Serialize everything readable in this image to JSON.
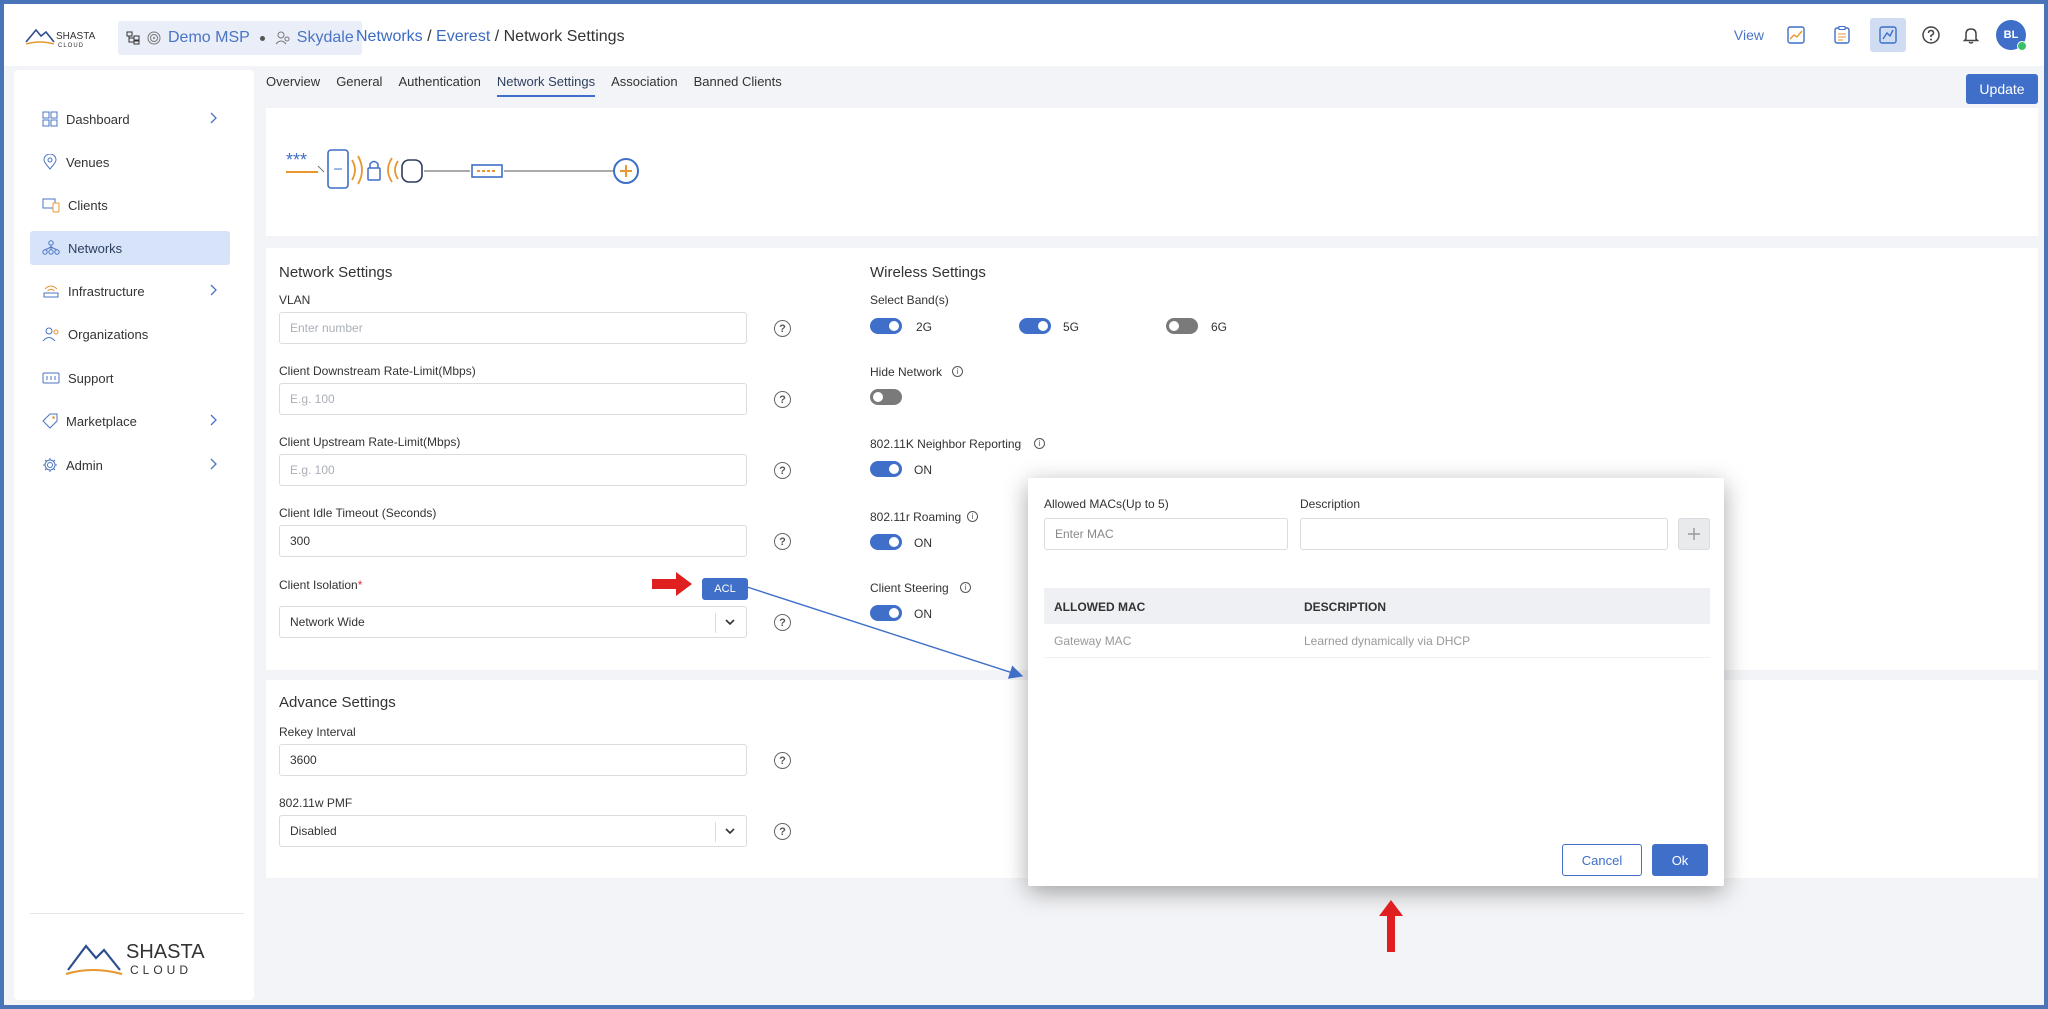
{
  "header": {
    "context": {
      "msp": "Demo MSP",
      "org": "Skydale"
    },
    "breadcrumb": [
      {
        "label": "Networks",
        "link": true
      },
      {
        "label": "Everest",
        "link": true
      },
      {
        "label": "Network Settings",
        "link": false
      }
    ],
    "view_label": "View",
    "avatar_initials": "BL",
    "brand_text_top": "SHASTA",
    "brand_text_bottom": "CLOUD"
  },
  "sidebar": {
    "items": [
      {
        "label": "Dashboard",
        "icon": "dashboard-icon",
        "has_children": true,
        "active": false
      },
      {
        "label": "Venues",
        "icon": "location-icon",
        "has_children": false,
        "active": false
      },
      {
        "label": "Clients",
        "icon": "devices-icon",
        "has_children": false,
        "active": false
      },
      {
        "label": "Networks",
        "icon": "network-icon",
        "has_children": false,
        "active": true
      },
      {
        "label": "Infrastructure",
        "icon": "access-point-icon",
        "has_children": true,
        "active": false
      },
      {
        "label": "Organizations",
        "icon": "organization-icon",
        "has_children": false,
        "active": false
      },
      {
        "label": "Support",
        "icon": "support-icon",
        "has_children": false,
        "active": false
      },
      {
        "label": "Marketplace",
        "icon": "tag-icon",
        "has_children": true,
        "active": false
      },
      {
        "label": "Admin",
        "icon": "gear-icon",
        "has_children": true,
        "active": false
      }
    ],
    "logo_top": "SHASTA",
    "logo_bottom": "CLOUD"
  },
  "tabs": [
    "Overview",
    "General",
    "Authentication",
    "Network Settings",
    "Association",
    "Banned Clients"
  ],
  "active_tab": "Network Settings",
  "update_label": "Update",
  "diagram": {
    "password_mask": "***"
  },
  "network_settings": {
    "title": "Network Settings",
    "vlan": {
      "label": "VLAN",
      "placeholder": "Enter number"
    },
    "downstream": {
      "label": "Client Downstream Rate-Limit(Mbps)",
      "placeholder": "E.g. 100"
    },
    "upstream": {
      "label": "Client Upstream Rate-Limit(Mbps)",
      "placeholder": "E.g. 100"
    },
    "idle_timeout": {
      "label": "Client Idle Timeout (Seconds)",
      "value": "300"
    },
    "isolation": {
      "label": "Client Isolation",
      "required_mark": "*",
      "value": "Network Wide",
      "acl_label": "ACL"
    }
  },
  "wireless_settings": {
    "title": "Wireless Settings",
    "bands_label": "Select Band(s)",
    "bands": [
      {
        "label": "2G",
        "on": true
      },
      {
        "label": "5G",
        "on": true
      },
      {
        "label": "6G",
        "on": false
      }
    ],
    "hide_network": {
      "label": "Hide Network",
      "on": false
    },
    "neighbor_reporting": {
      "label": "802.11K Neighbor Reporting",
      "on": true,
      "state": "ON"
    },
    "roaming": {
      "label": "802.11r Roaming",
      "on": true,
      "state": "ON"
    },
    "steering": {
      "label": "Client Steering",
      "on": true,
      "state": "ON"
    }
  },
  "advance_settings": {
    "title": "Advance Settings",
    "rekey": {
      "label": "Rekey Interval",
      "value": "3600"
    },
    "pmf": {
      "label": "802.11w PMF",
      "value": "Disabled"
    }
  },
  "acl_modal": {
    "mac_label": "Allowed MACs(Up to 5)",
    "mac_placeholder": "Enter MAC",
    "desc_label": "Description",
    "columns": [
      "ALLOWED MAC",
      "DESCRIPTION"
    ],
    "rows": [
      {
        "mac": "Gateway MAC",
        "description": "Learned dynamically via DHCP"
      }
    ],
    "cancel_label": "Cancel",
    "ok_label": "Ok"
  },
  "colors": {
    "accent": "#3f6fc8",
    "frame": "#4a74b8",
    "annotation": "#e02020"
  }
}
